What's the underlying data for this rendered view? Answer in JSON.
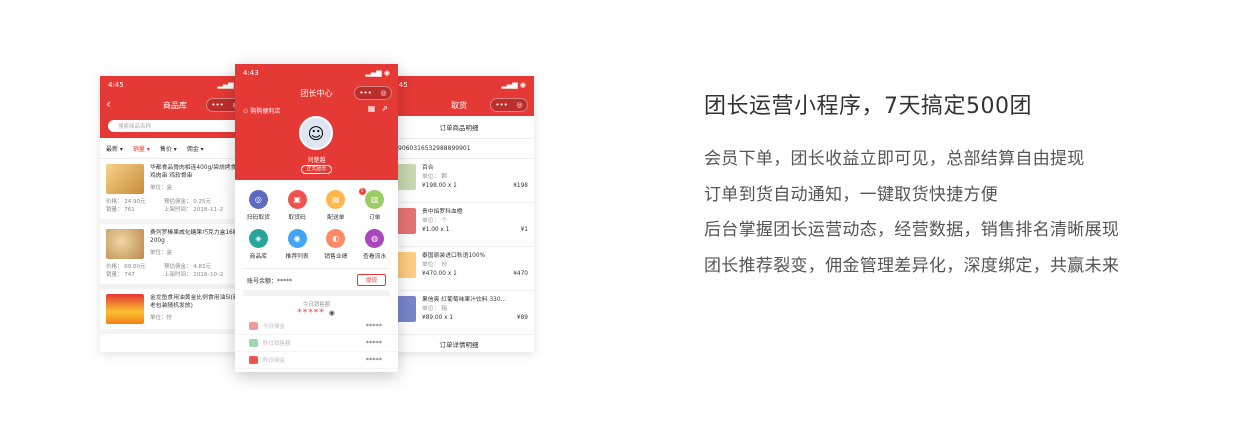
{
  "left_phone": {
    "time": "4:45",
    "title": "商品库",
    "search_placeholder": "搜索商品名称",
    "sort_tabs": [
      "最新 ▾",
      "销量 ▾",
      "售价 ▾",
      "佣金 ▾"
    ],
    "products": [
      {
        "title": "华都食品骨肉相连400g/袋烧烤食材鸡肉串 鸡软骨串",
        "unit_label": "单位：",
        "unit": "盒",
        "price": "价格：  24.90元",
        "commission": "预估佣金：  0.25元",
        "sales": "销量：  761",
        "shelf": "上架时间：  2018–11–2"
      },
      {
        "title": "费列罗榛果威化糖果巧克力盒16粒200g",
        "unit_label": "单位：",
        "unit": "盒",
        "price": "价格：  69.00元",
        "commission": "预估佣金：  4.83元",
        "sales": "销量：  747",
        "shelf": "上架时间：  2018–10–2"
      },
      {
        "title": "金龙鱼食用油黄金比例食用油5l(新老包装随机发放)",
        "unit_label": "单位：",
        "unit": "份"
      }
    ]
  },
  "center_phone": {
    "time": "4:43",
    "title": "团长中心",
    "shop_name": "购购便利店",
    "user_name": "刘楚越",
    "user_badge": "正式团长",
    "grid": [
      {
        "label": "扫码取货",
        "icon": "scan-icon",
        "color": "#5c6bc0",
        "glyph": "◎"
      },
      {
        "label": "取货码",
        "icon": "code-icon",
        "color": "#ef5350",
        "glyph": "▣"
      },
      {
        "label": "配送单",
        "icon": "delivery-icon",
        "color": "#ffb74d",
        "glyph": "▤",
        "badge": "1"
      },
      {
        "label": "订单",
        "icon": "order-icon",
        "color": "#9ccc65",
        "glyph": "▥"
      },
      {
        "label": "商品库",
        "icon": "library-icon",
        "color": "#26a69a",
        "glyph": "◈"
      },
      {
        "label": "推荐列表",
        "icon": "recommend-icon",
        "color": "#42a5f5",
        "glyph": "◉"
      },
      {
        "label": "销售业绩",
        "icon": "performance-icon",
        "color": "#ff8a65",
        "glyph": "◐"
      },
      {
        "label": "查看流水",
        "icon": "flow-icon",
        "color": "#ab47bc",
        "glyph": "◍"
      }
    ],
    "balance_label": "账号余额：*****",
    "withdraw": "提现",
    "sales_title": "今日销售额",
    "sales_value": "*****",
    "stats": [
      {
        "label": "今日佣金",
        "value": "*****",
        "color": "#ef9a9a"
      },
      {
        "label": "昨日销售额",
        "value": "*****",
        "color": "#a5d6a7"
      },
      {
        "label": "昨日佣金",
        "value": "*****",
        "color": "#ef5350"
      }
    ]
  },
  "right_phone": {
    "time": "4:45",
    "title": "取货",
    "order_title": "订单商品明细",
    "order_no": "906031653298889990​1",
    "items": [
      {
        "name": "百合",
        "unit": "单位：  颗",
        "price": "¥198.00 x 1",
        "total": "¥198",
        "color": "#c8d8b0"
      },
      {
        "name": "贵中焰罗科血橙",
        "unit": "单位：  个",
        "price": "¥1.00 x 1",
        "total": "¥1",
        "color": "#e57373"
      },
      {
        "name": "泰国原装进口秋语100%",
        "unit": "单位：  份",
        "price": "¥470.00 x 1",
        "total": "¥470",
        "color": "#ffcc80"
      },
      {
        "name": "果信爽 红葡萄味果汁饮料 330...",
        "unit": "单位：  箱",
        "price": "¥89.00 x 1",
        "total": "¥89",
        "color": "#7986cb"
      }
    ],
    "footer": "订单详情明细"
  },
  "copy": {
    "headline": "团长运营小程序，7天搞定500团",
    "lines": [
      "会员下单，团长收益立即可见，总部结算自由提现",
      "订单到货自动通知，一键取货快捷方便",
      "后台掌握团长运营动态，经营数据，销售排名清晰展现",
      "团长推荐裂变，佣金管理差异化，深度绑定，共赢未来"
    ]
  }
}
